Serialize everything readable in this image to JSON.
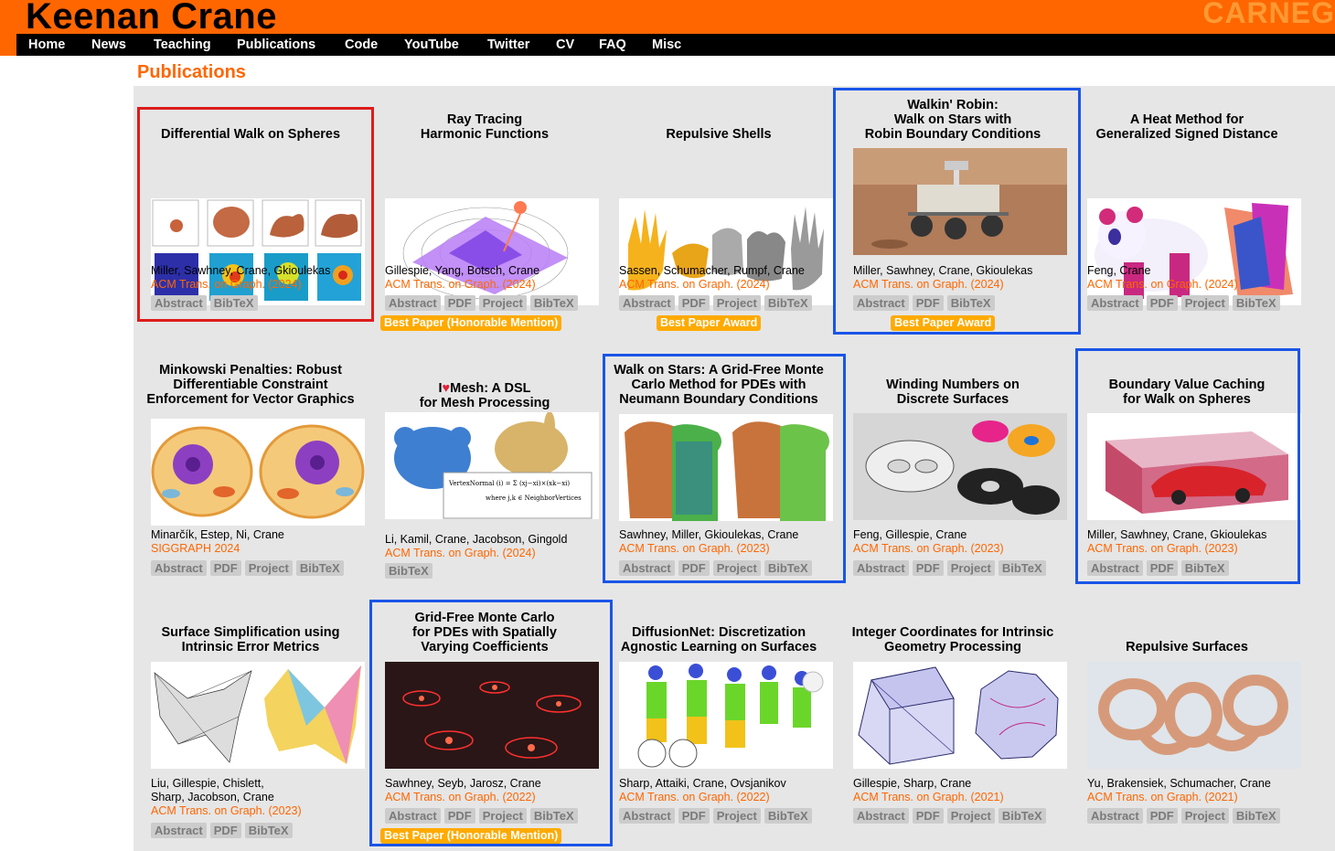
{
  "site": {
    "title": "Keenan Crane",
    "affiliation_banner": "CARNEG"
  },
  "nav": [
    "Home",
    "News",
    "Teaching",
    "Publications",
    "Code",
    "YouTube",
    "Twitter",
    "CV",
    "FAQ",
    "Misc"
  ],
  "page_title": "Publications",
  "colors": {
    "brand_orange": "#ff6600",
    "award_gold": "#ffaa00",
    "highlight_blue": "#1a55e8",
    "highlight_red": "#dd1c1c"
  },
  "publications": [
    {
      "title": [
        "Differential Walk on Spheres"
      ],
      "authors": [
        "Miller, Sawhney, Crane, Gkioulekas"
      ],
      "venue": "ACM Trans. on Graph. (2024)",
      "links": [
        "Abstract",
        "BibTeX"
      ],
      "award": "",
      "thumb": "spheres-cubes-icon"
    },
    {
      "title": [
        "Ray Tracing",
        "Harmonic Functions"
      ],
      "authors": [
        "Gillespie, Yang, Botsch, Crane"
      ],
      "venue": "ACM Trans. on Graph. (2024)",
      "links": [
        "Abstract",
        "PDF",
        "Project",
        "BibTeX"
      ],
      "award": "Best Paper (Honorable Mention)",
      "thumb": "harmonic-surface-icon"
    },
    {
      "title": [
        "Repulsive Shells"
      ],
      "authors": [
        "Sassen, Schumacher, Rumpf, Crane"
      ],
      "venue": "ACM Trans. on Graph. (2024)",
      "links": [
        "Abstract",
        "PDF",
        "Project",
        "BibTeX"
      ],
      "award": "Best Paper Award",
      "thumb": "gloves-icon"
    },
    {
      "title": [
        "Walkin' Robin:",
        "Walk on Stars with",
        "Robin Boundary Conditions"
      ],
      "authors": [
        "Miller, Sawhney, Crane, Gkioulekas"
      ],
      "venue": "ACM Trans. on Graph. (2024)",
      "links": [
        "Abstract",
        "PDF",
        "BibTeX"
      ],
      "award": "Best Paper Award",
      "thumb": "mars-rover-icon"
    },
    {
      "title": [
        "A Heat Method for",
        "Generalized Signed Distance"
      ],
      "authors": [
        "Feng, Crane"
      ],
      "venue": "ACM Trans. on Graph. (2024)",
      "links": [
        "Abstract",
        "PDF",
        "Project",
        "BibTeX"
      ],
      "award": "",
      "thumb": "panda-icon"
    },
    {
      "title": [
        "Minkowski Penalties: Robust",
        "Differentiable Constraint",
        "Enforcement for Vector Graphics"
      ],
      "authors": [
        "Minarčík, Estep, Ni, Crane"
      ],
      "venue": "SIGGRAPH 2024",
      "links": [
        "Abstract",
        "PDF",
        "Project",
        "BibTeX"
      ],
      "award": "",
      "thumb": "cells-icon"
    },
    {
      "title": [
        "Mesh: A DSL",
        "for Mesh Processing"
      ],
      "title_prefix": "I",
      "authors": [
        "Li, Kamil, Crane, Jacobson, Gingold"
      ],
      "venue": "ACM Trans. on Graph. (2024)",
      "links": [
        "BibTeX"
      ],
      "award": "",
      "thumb": "mesh-monkey-icon"
    },
    {
      "title": [
        "Walk on Stars: A Grid-Free Monte",
        "Carlo Method for PDEs with",
        "Neumann Boundary Conditions"
      ],
      "authors": [
        "Sawhney, Miller, Gkioulekas, Crane"
      ],
      "venue": "ACM Trans. on Graph. (2023)",
      "links": [
        "Abstract",
        "PDF",
        "Project",
        "BibTeX"
      ],
      "award": "",
      "thumb": "toast-icon"
    },
    {
      "title": [
        "Winding Numbers on",
        "Discrete Surfaces"
      ],
      "authors": [
        "Feng, Gillespie, Crane"
      ],
      "venue": "ACM Trans. on Graph. (2023)",
      "links": [
        "Abstract",
        "PDF",
        "Project",
        "BibTeX"
      ],
      "award": "",
      "thumb": "torus-icon"
    },
    {
      "title": [
        "Boundary Value Caching",
        "for Walk on Spheres"
      ],
      "authors": [
        "Miller, Sawhney, Crane, Gkioulekas"
      ],
      "venue": "ACM Trans. on Graph. (2023)",
      "links": [
        "Abstract",
        "PDF",
        "BibTeX"
      ],
      "award": "",
      "thumb": "car-icon"
    },
    {
      "title": [
        "Surface Simplification using",
        "Intrinsic Error Metrics"
      ],
      "authors": [
        "Liu, Gillespie, Chislett,",
        "Sharp, Jacobson, Crane"
      ],
      "venue": "ACM Trans. on Graph. (2023)",
      "links": [
        "Abstract",
        "PDF",
        "BibTeX"
      ],
      "award": "",
      "thumb": "simplified-mesh-icon"
    },
    {
      "title": [
        "Grid-Free Monte Carlo",
        "for PDEs with Spatially",
        "Varying Coefficients"
      ],
      "authors": [
        "Sawhney, Seyb, Jarosz, Crane"
      ],
      "venue": "ACM Trans. on Graph. (2022)",
      "links": [
        "Abstract",
        "PDF",
        "Project",
        "BibTeX"
      ],
      "award": "Best Paper (Honorable Mention)",
      "thumb": "red-lights-icon"
    },
    {
      "title": [
        "DiffusionNet: Discretization",
        "Agnostic Learning on Surfaces"
      ],
      "authors": [
        "Sharp, Attaiki, Crane, Ovsjanikov"
      ],
      "venue": "ACM Trans. on Graph. (2022)",
      "links": [
        "Abstract",
        "PDF",
        "Project",
        "BibTeX"
      ],
      "award": "",
      "thumb": "humans-icon"
    },
    {
      "title": [
        "Integer Coordinates for Intrinsic",
        "Geometry Processing"
      ],
      "authors": [
        "Gillespie, Sharp, Crane"
      ],
      "venue": "ACM Trans. on Graph. (2021)",
      "links": [
        "Abstract",
        "PDF",
        "Project",
        "BibTeX"
      ],
      "award": "",
      "thumb": "cube-icon"
    },
    {
      "title": [
        "Repulsive Surfaces"
      ],
      "authors": [
        "Yu, Brakensiek, Schumacher, Crane"
      ],
      "venue": "ACM Trans. on Graph. (2021)",
      "links": [
        "Abstract",
        "PDF",
        "Project",
        "BibTeX"
      ],
      "award": "",
      "thumb": "knot-icon"
    }
  ]
}
